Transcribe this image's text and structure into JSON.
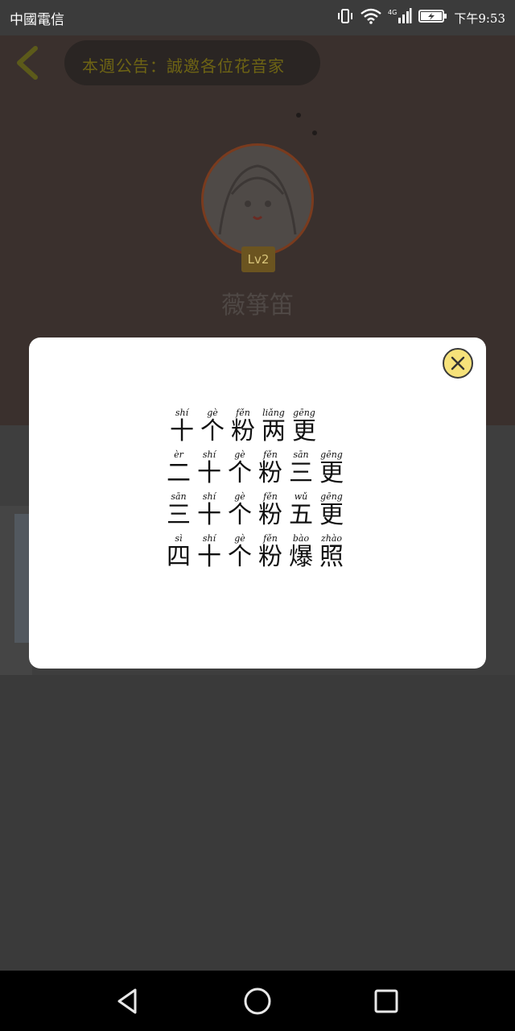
{
  "status_bar": {
    "carrier": "中國電信",
    "network": "4G",
    "time": "下午9:53"
  },
  "header": {
    "notice": "本週公告：誠邀各位花音家"
  },
  "profile": {
    "level": "Lv2",
    "nickname": "薇箏笛"
  },
  "modal": {
    "lines": [
      [
        {
          "py": "shí",
          "hz": "十"
        },
        {
          "py": "gè",
          "hz": "个"
        },
        {
          "py": "fěn",
          "hz": "粉"
        },
        {
          "py": "liǎng",
          "hz": "两"
        },
        {
          "py": "gēng",
          "hz": "更"
        }
      ],
      [
        {
          "py": "èr",
          "hz": "二"
        },
        {
          "py": "shí",
          "hz": "十"
        },
        {
          "py": "gè",
          "hz": "个"
        },
        {
          "py": "fěn",
          "hz": "粉"
        },
        {
          "py": "sān",
          "hz": "三"
        },
        {
          "py": "gēng",
          "hz": "更"
        }
      ],
      [
        {
          "py": "sān",
          "hz": "三"
        },
        {
          "py": "shí",
          "hz": "十"
        },
        {
          "py": "gè",
          "hz": "个"
        },
        {
          "py": "fěn",
          "hz": "粉"
        },
        {
          "py": "wǔ",
          "hz": "五"
        },
        {
          "py": "gēng",
          "hz": "更"
        }
      ],
      [
        {
          "py": "sì",
          "hz": "四"
        },
        {
          "py": "shí",
          "hz": "十"
        },
        {
          "py": "gè",
          "hz": "个"
        },
        {
          "py": "fěn",
          "hz": "粉"
        },
        {
          "py": "bào",
          "hz": "爆"
        },
        {
          "py": "zhào",
          "hz": "照"
        }
      ]
    ],
    "close_icon": "close-circle-icon"
  },
  "nav": {
    "back_icon": "triangle-back-icon",
    "home_icon": "circle-home-icon",
    "recents_icon": "square-recents-icon"
  },
  "colors": {
    "close_button": "#f6e27a",
    "overlay": "#3a3a3a"
  }
}
